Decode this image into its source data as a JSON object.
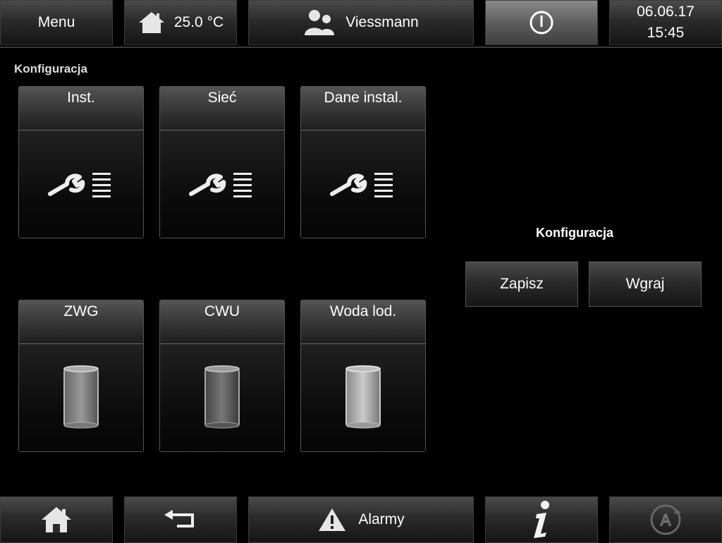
{
  "topbar": {
    "menu_label": "Menu",
    "temperature": "25.0 °C",
    "user": "Viessmann",
    "power_icon": "power-icon",
    "date": "06.06.17",
    "time": "15:45"
  },
  "section_title": "Konfiguracja",
  "tiles": [
    {
      "label": "Inst.",
      "icon": "wrench-list-icon"
    },
    {
      "label": "Sieć",
      "icon": "wrench-list-icon"
    },
    {
      "label": "Dane instal.",
      "icon": "wrench-list-icon"
    },
    {
      "label": "ZWG",
      "icon": "tank-icon"
    },
    {
      "label": "CWU",
      "icon": "tank-icon"
    },
    {
      "label": "Woda lod.",
      "icon": "tank-icon"
    }
  ],
  "config": {
    "label": "Konfiguracja",
    "save_label": "Zapisz",
    "load_label": "Wgraj"
  },
  "bottombar": {
    "alarms_label": "Alarmy",
    "icons": [
      "home-icon",
      "back-arrow-icon",
      "warning-icon",
      "info-icon",
      "auto-mode-icon"
    ]
  }
}
